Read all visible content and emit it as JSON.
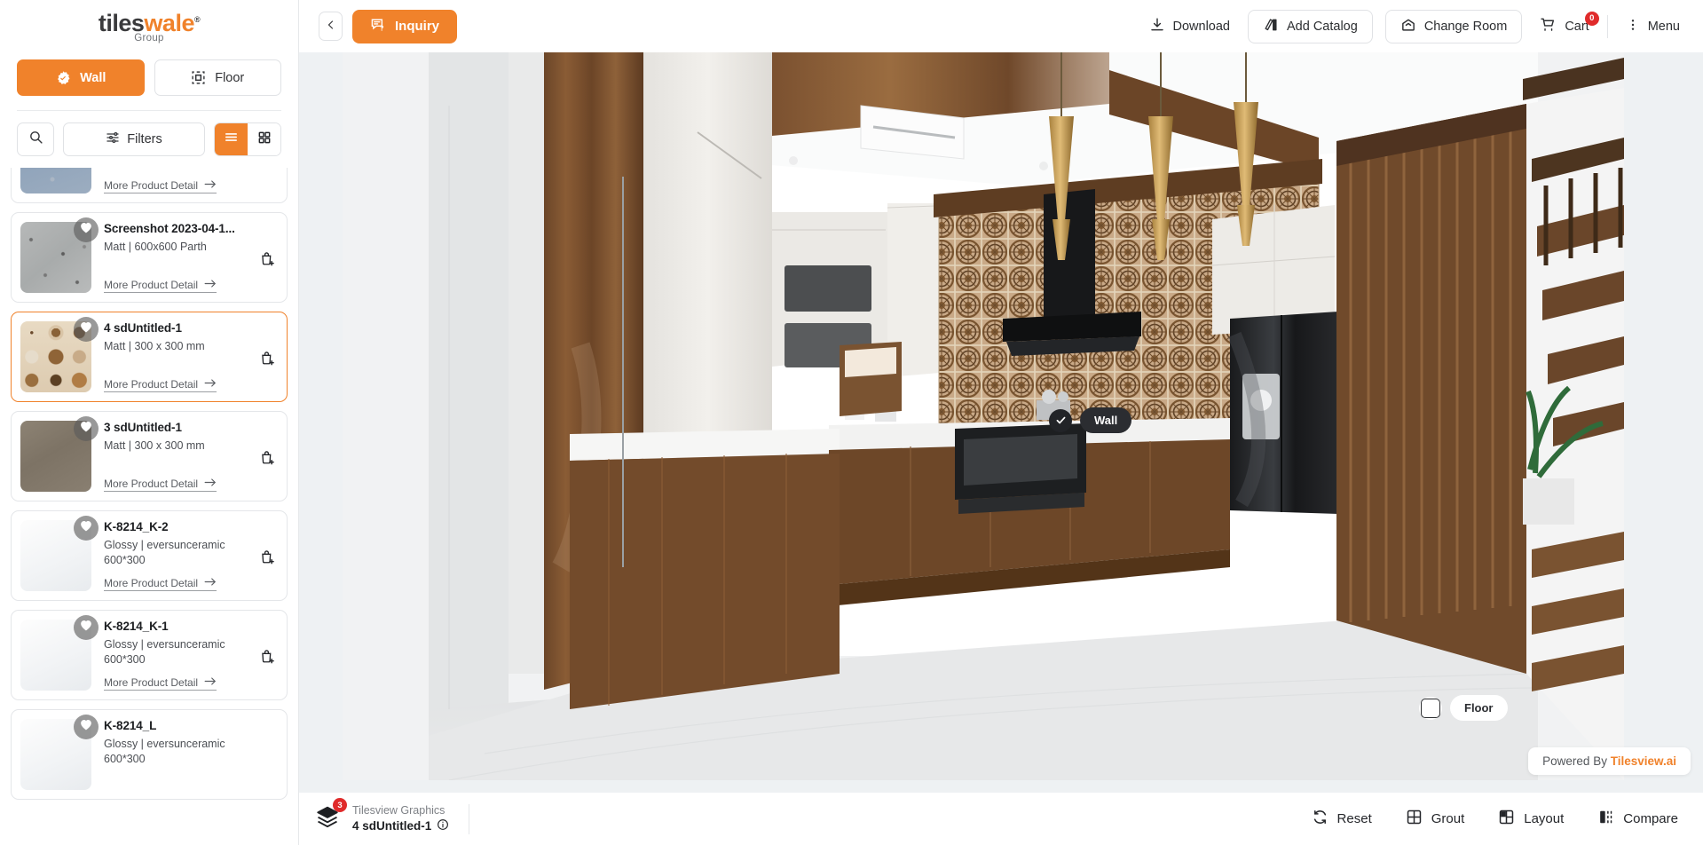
{
  "brand": {
    "logo_tiles": "tiles",
    "logo_wale": "wale",
    "logo_registered": "®",
    "logo_sub": "Group"
  },
  "sidebar": {
    "surface_tabs": [
      {
        "label": "Wall",
        "icon": "check-badge-icon",
        "active": true
      },
      {
        "label": "Floor",
        "icon": "floor-grid-icon",
        "active": false
      }
    ],
    "search_icon": "search-icon",
    "filters_label": "Filters",
    "view_modes": [
      {
        "icon": "list-view-icon",
        "active": true
      },
      {
        "icon": "grid-view-icon",
        "active": false
      }
    ],
    "more_detail_label": "More Product Detail",
    "products": [
      {
        "title": "",
        "sub": "",
        "texture": "tx-blue",
        "selected": false,
        "partial_top": true
      },
      {
        "title": "Screenshot 2023-04-1...",
        "sub": "Matt | 600x600 Parth",
        "texture": "tx-grey",
        "selected": false
      },
      {
        "title": "4 sdUntitled-1",
        "sub": "Matt | 300 x 300 mm",
        "texture": "tx-patt",
        "selected": true
      },
      {
        "title": "3 sdUntitled-1",
        "sub": "Matt | 300 x 300 mm",
        "texture": "tx-brown",
        "selected": false
      },
      {
        "title": "K-8214_K-2",
        "sub": "Glossy | eversunceramic 600*300",
        "texture": "tx-marble",
        "selected": false
      },
      {
        "title": "K-8214_K-1",
        "sub": "Glossy | eversunceramic 600*300",
        "texture": "tx-marble",
        "selected": false
      },
      {
        "title": "K-8214_L",
        "sub": "Glossy | eversunceramic 600*300",
        "texture": "tx-marble",
        "selected": false
      }
    ]
  },
  "topbar": {
    "back_icon": "chevron-left-icon",
    "inquiry_label": "Inquiry",
    "inquiry_icon": "chat-question-icon",
    "download_label": "Download",
    "download_icon": "download-icon",
    "add_catalog_label": "Add Catalog",
    "add_catalog_icon": "catalog-icon",
    "change_room_label": "Change Room",
    "change_room_icon": "home-icon",
    "cart_label": "Cart",
    "cart_icon": "cart-icon",
    "cart_count": "0",
    "menu_label": "Menu",
    "menu_icon": "dots-vertical-icon"
  },
  "stage": {
    "wall_chip_label": "Wall",
    "wall_chip_state": "checked",
    "floor_chip_label": "Floor",
    "floor_chip_state": "unchecked",
    "powered_prefix": "Powered By ",
    "powered_brand": "Tilesview.ai"
  },
  "bottombar": {
    "layers_icon": "layers-icon",
    "layers_count": "3",
    "group_label": "Tilesview Graphics",
    "selected_tile": "4 sdUntitled-1",
    "info_icon": "info-icon",
    "actions": [
      {
        "label": "Reset",
        "icon": "reset-icon"
      },
      {
        "label": "Grout",
        "icon": "grout-grid-icon"
      },
      {
        "label": "Layout",
        "icon": "layout-icon"
      },
      {
        "label": "Compare",
        "icon": "compare-icon"
      }
    ]
  },
  "colors": {
    "accent": "#f0822b",
    "badge_red": "#e02b2b",
    "dark_chip": "#2b2d31"
  }
}
